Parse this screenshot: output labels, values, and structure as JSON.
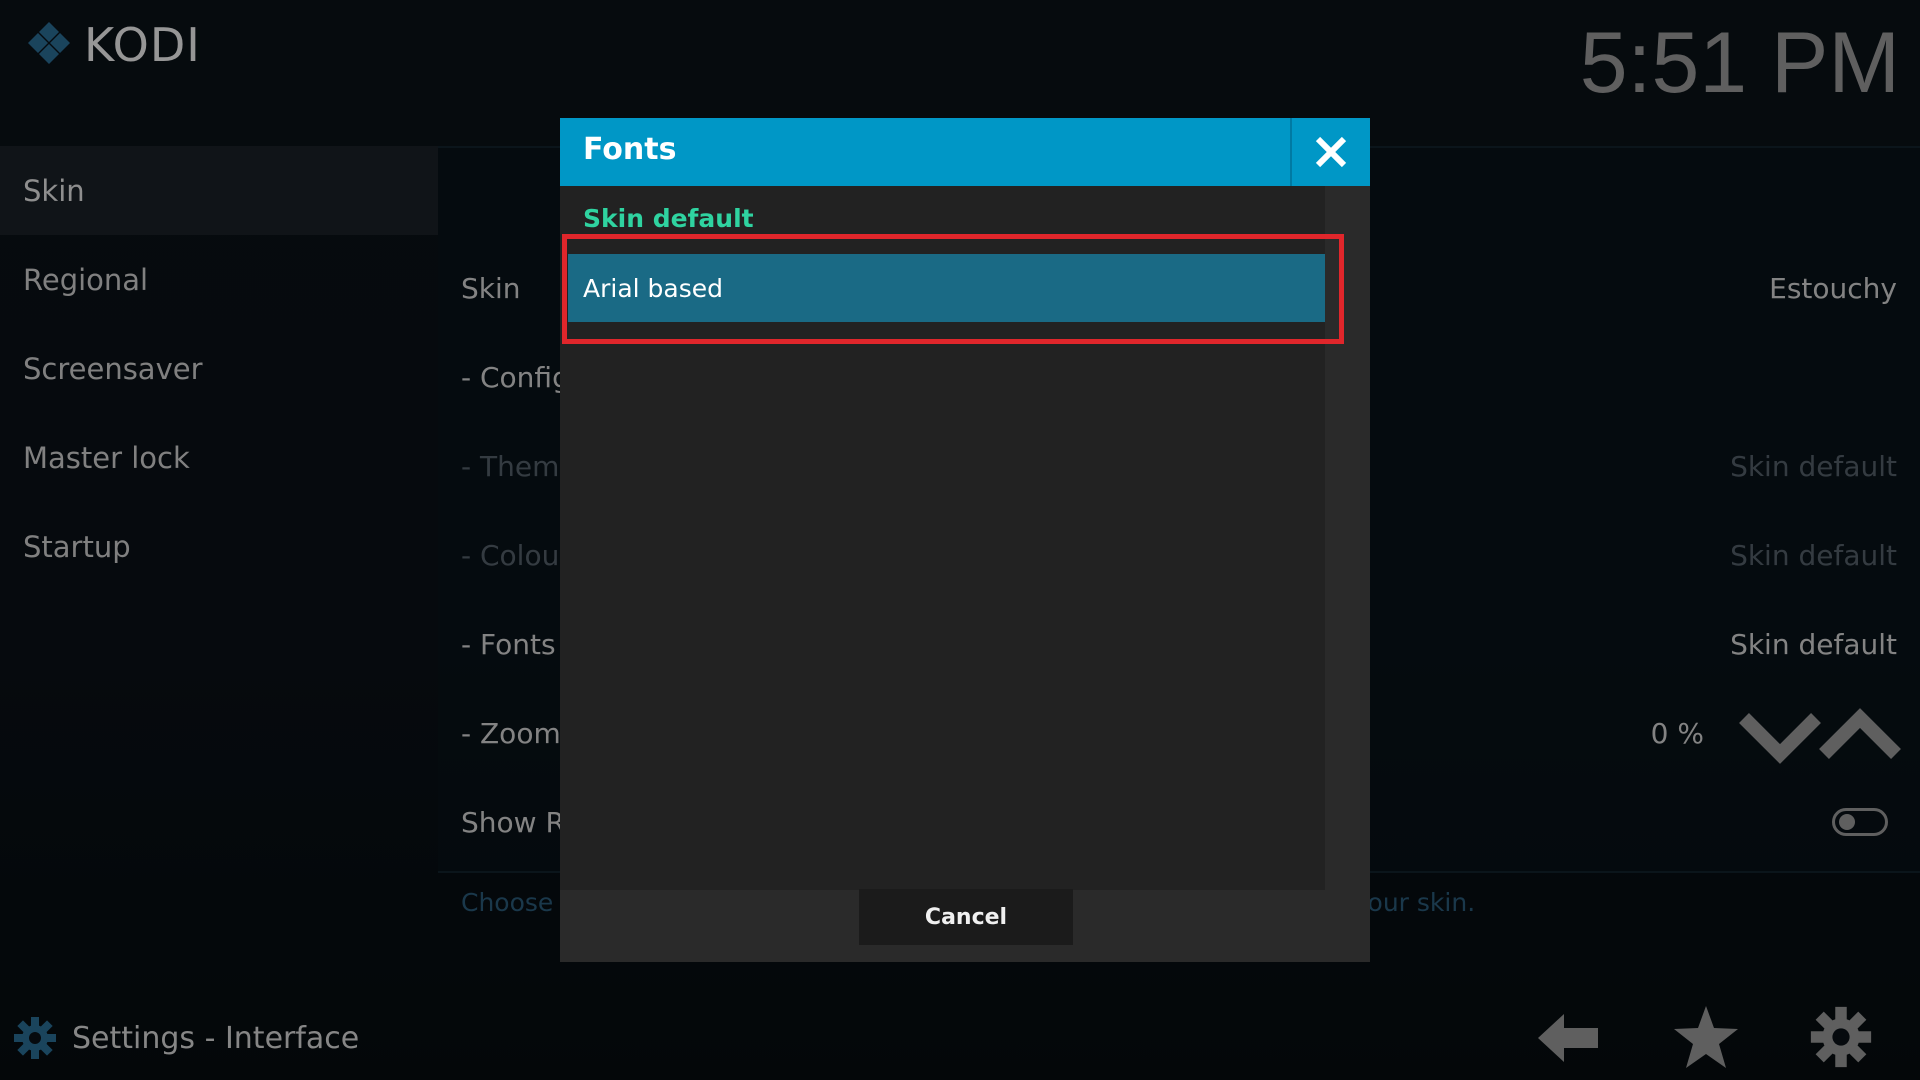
{
  "app": {
    "logo_text": "KODI",
    "clock": "5:51 PM"
  },
  "sidebar": {
    "items": [
      {
        "label": "Skin",
        "active": true
      },
      {
        "label": "Regional"
      },
      {
        "label": "Screensaver"
      },
      {
        "label": "Master lock"
      },
      {
        "label": "Startup"
      }
    ]
  },
  "settings": {
    "rows": [
      {
        "label": "Skin",
        "value": "Estouchy"
      },
      {
        "label": "- Config",
        "value": ""
      },
      {
        "label": "- Theme",
        "value": "Skin default"
      },
      {
        "label": "- Colour",
        "value": "Skin default"
      },
      {
        "label": "- Fonts",
        "value": "Skin default"
      },
      {
        "label": "- Zoom",
        "value": "0 %"
      },
      {
        "label": "Show R",
        "value": ""
      }
    ],
    "description_left": "Choose t",
    "description_right": "y your skin."
  },
  "footer": {
    "title": "Settings - Interface"
  },
  "dialog": {
    "title": "Fonts",
    "options": [
      {
        "label": "Skin default",
        "selected": true
      },
      {
        "label": "Arial based",
        "focused": true
      }
    ],
    "cancel_label": "Cancel"
  },
  "colors": {
    "accent": "#0097c6",
    "selected_text": "#2fd3a0",
    "focused_item": "#1a6a85",
    "highlight_box": "#e0262b"
  },
  "icons": {
    "logo": "kodi-logo-icon",
    "close": "close-icon",
    "zoom_down": "chevron-down-icon",
    "zoom_up": "chevron-up-icon",
    "settings": "gear-icon",
    "back": "back-arrow-icon",
    "favourites": "star-icon"
  }
}
